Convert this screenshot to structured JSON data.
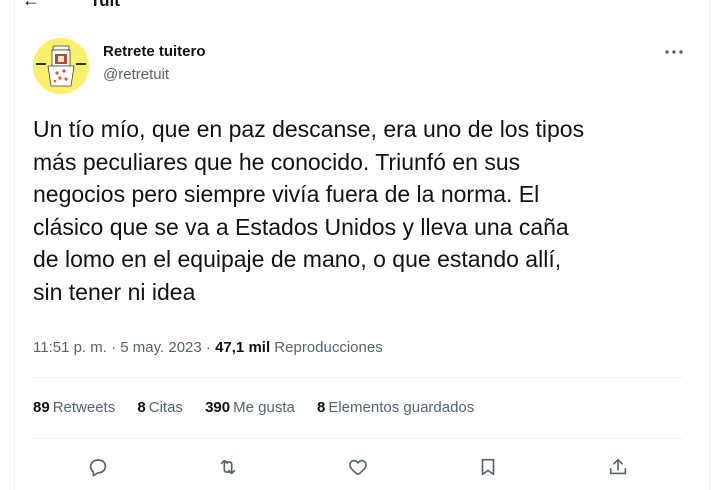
{
  "header": {
    "back_glyph": "←",
    "title_fragment": "Tuit"
  },
  "author": {
    "name": "Retrete tuitero",
    "handle": "@retretuit"
  },
  "tweet": {
    "text": "Un tío mío, que en paz descanse, era uno de los tipos\nmás peculiares que he conocido. Triunfó en sus\nnegocios pero siempre vivía fuera de la norma. El\nclásico que se va a Estados Unidos y lleva una caña\nde lomo en el equipaje de mano, o que estando allí,\nsin tener ni idea",
    "time": "11:51 p. m.",
    "sep1": " · ",
    "date": "5 may. 2023",
    "sep2": " · ",
    "views_count": "47,1 mil",
    "views_label": "Reproducciones"
  },
  "stats": [
    {
      "count": "89",
      "label": "Retweets"
    },
    {
      "count": "8",
      "label": "Citas"
    },
    {
      "count": "390",
      "label": "Me gusta"
    },
    {
      "count": "8",
      "label": "Elementos guardados"
    }
  ],
  "actions": [
    "reply-icon",
    "retweet-icon",
    "like-icon",
    "bookmark-icon",
    "share-icon"
  ],
  "colors": {
    "text": "#0f1419",
    "secondary": "#536471",
    "divider": "#eff3f4",
    "avatar_bg": "#fbf06b"
  }
}
